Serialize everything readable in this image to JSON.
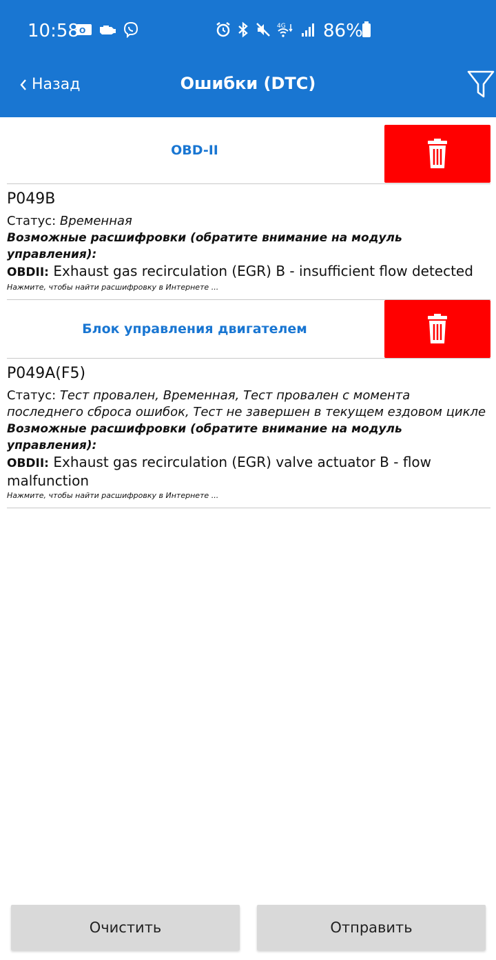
{
  "status_bar": {
    "time": "10:58",
    "battery": "86%"
  },
  "header": {
    "back_label": "Назад",
    "title": "Ошибки (DTC)"
  },
  "sections": [
    {
      "header_label": "OBD-II",
      "items": [
        {
          "code": "P049B",
          "status_label": "Статус:",
          "status_value": "Временная",
          "decode_title": "Возможные расшифровки (обратите внимание на модуль управления):",
          "decode_source": "OBDII:",
          "decode_text": "Exhaust gas recirculation (EGR) B - insufficient flow detected",
          "search_hint": "Нажмите, чтобы найти расшифровку в Интернете ..."
        }
      ]
    },
    {
      "header_label": "Блок управления двигателем",
      "items": [
        {
          "code": "P049A(F5)",
          "status_label": "Статус:",
          "status_value": "Тест провален, Временная, Тест провален с момента последнего сброса ошибок, Тест не завершен в текущем ездовом цикле",
          "decode_title": "Возможные расшифровки (обратите внимание на модуль управления):",
          "decode_source": "OBDII:",
          "decode_text": "Exhaust gas recirculation (EGR) valve actuator B - flow malfunction",
          "search_hint": "Нажмите, чтобы найти расшифровку в Интернете ..."
        }
      ]
    }
  ],
  "footer": {
    "clear_label": "Очистить",
    "send_label": "Отправить"
  },
  "colors": {
    "primary": "#1976d2",
    "delete": "#ff0000",
    "button_bg": "#d9d9d9"
  },
  "icons": {
    "back": "chevron-left-icon",
    "filter": "filter-icon",
    "delete": "trash-icon"
  }
}
